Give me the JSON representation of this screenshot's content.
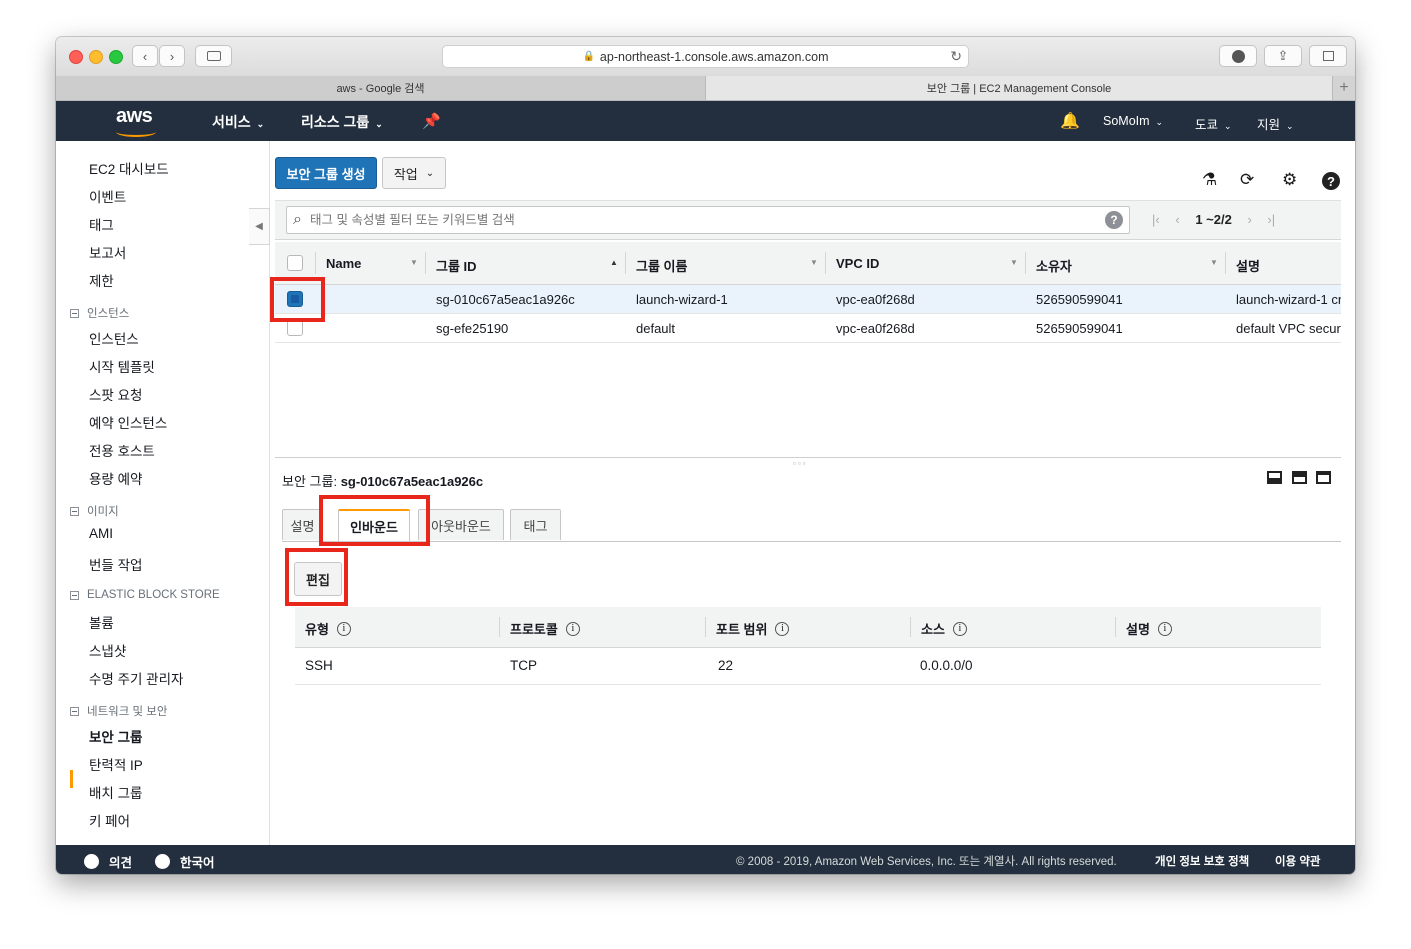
{
  "browser": {
    "url": "ap-northeast-1.console.aws.amazon.com",
    "tabs": [
      {
        "label": "aws - Google 검색"
      },
      {
        "label": "보안 그룹 | EC2 Management Console"
      }
    ]
  },
  "topnav": {
    "logo": "aws",
    "services": "서비스",
    "resource_groups": "리소스 그룹",
    "account": "SoMoIm",
    "region": "도쿄",
    "support": "지원"
  },
  "sidebar": {
    "items_top": [
      "EC2 대시보드",
      "이벤트",
      "태그",
      "보고서",
      "제한"
    ],
    "sections": [
      {
        "title": "인스턴스",
        "items": [
          "인스턴스",
          "시작 템플릿",
          "스팟 요청",
          "예약 인스턴스",
          "전용 호스트",
          "용량 예약"
        ]
      },
      {
        "title": "이미지",
        "items": [
          "AMI",
          "번들 작업"
        ]
      },
      {
        "title": "ELASTIC BLOCK STORE",
        "items": [
          "볼륨",
          "스냅샷",
          "수명 주기 관리자"
        ]
      },
      {
        "title": "네트워크 및 보안",
        "items": [
          "보안 그룹",
          "탄력적 IP",
          "배치 그룹",
          "키 페어"
        ]
      }
    ]
  },
  "toolbar": {
    "create_label": "보안 그룹 생성",
    "actions_label": "작업"
  },
  "search": {
    "placeholder": "태그 및 속성별 필터 또는 키워드별 검색",
    "pager": "1 ~2/2"
  },
  "grid": {
    "columns": [
      "Name",
      "그룹 ID",
      "그룹 이름",
      "VPC ID",
      "소유자",
      "설명"
    ],
    "rows": [
      {
        "name": "",
        "group_id": "sg-010c67a5eac1a926c",
        "group_name": "launch-wizard-1",
        "vpc": "vpc-ea0f268d",
        "owner": "526590599041",
        "desc": "launch-wizard-1 cr",
        "selected": true
      },
      {
        "name": "",
        "group_id": "sg-efe25190",
        "group_name": "default",
        "vpc": "vpc-ea0f268d",
        "owner": "526590599041",
        "desc": "default VPC securi",
        "selected": false
      }
    ]
  },
  "detail": {
    "title_prefix": "보안 그룹:",
    "title_value": "sg-010c67a5eac1a926c",
    "tabs": [
      "설명",
      "인바운드",
      "아웃바운드",
      "태그"
    ],
    "active_tab": "인바운드",
    "edit_label": "편집",
    "rule_columns": [
      "유형",
      "프로토콜",
      "포트 범위",
      "소스",
      "설명"
    ],
    "info_glyph": "i",
    "rules": [
      {
        "type": "SSH",
        "protocol": "TCP",
        "port": "22",
        "source": "0.0.0.0/0",
        "desc": ""
      }
    ]
  },
  "footer": {
    "feedback": "의견",
    "language": "한국어",
    "copyright": "© 2008 - 2019, Amazon Web Services, Inc. 또는 계열사. All rights reserved.",
    "privacy": "개인 정보 보호 정책",
    "terms": "이용 약관"
  },
  "colors": {
    "nav_bg": "#232f3e",
    "primary": "#1f73b7",
    "accent": "#ff9900",
    "highlight": "#e8261b"
  }
}
